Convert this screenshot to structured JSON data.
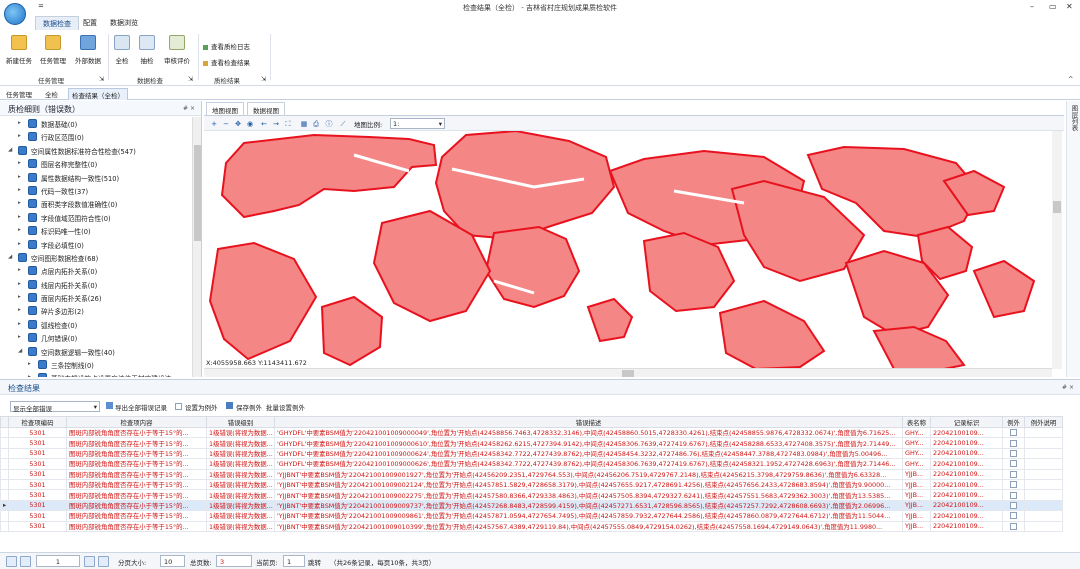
{
  "window": {
    "title": "检查结果（全检） - 吉林省村庄规划成果质检软件",
    "quick_access": "="
  },
  "menu_tabs": [
    "数据检查",
    "配置",
    "数据浏览"
  ],
  "ribbon": {
    "groups": [
      {
        "label": "任务管理",
        "buttons": [
          "新建任务",
          "任务管理",
          "外部数据"
        ]
      },
      {
        "label": "数据检查",
        "buttons": [
          "全检",
          "抽检",
          "审核评价"
        ]
      },
      {
        "label": "质检结果",
        "buttons": [
          "查看质检日志",
          "查看检查结果"
        ]
      }
    ]
  },
  "doc_tabs": [
    "任务管理",
    "全检",
    "检查结果（全检）"
  ],
  "left_panel": {
    "title": "质检细则（错误数）",
    "pin": "# ×",
    "tree": [
      {
        "label": "数据基础(0)",
        "level": 1,
        "expanded": false
      },
      {
        "label": "行政区范围(0)",
        "level": 1,
        "expanded": false
      },
      {
        "label": "空间属性数据标准符合性检查(547)",
        "level": 0,
        "expanded": true
      },
      {
        "label": "图层名称完整性(0)",
        "level": 1,
        "expanded": false
      },
      {
        "label": "属性数据结构一致性(510)",
        "level": 1,
        "expanded": false
      },
      {
        "label": "代码一致性(37)",
        "level": 1,
        "expanded": false
      },
      {
        "label": "面积类字段数值准确性(0)",
        "level": 1,
        "expanded": false
      },
      {
        "label": "字段值域范围符合性(0)",
        "level": 1,
        "expanded": false
      },
      {
        "label": "标识码唯一性(0)",
        "level": 1,
        "expanded": false
      },
      {
        "label": "字段必填性(0)",
        "level": 1,
        "expanded": false
      },
      {
        "label": "空间图形数据检查(68)",
        "level": 0,
        "expanded": true
      },
      {
        "label": "点层内拓扑关系(0)",
        "level": 1,
        "expanded": false
      },
      {
        "label": "线层内拓扑关系(0)",
        "level": 1,
        "expanded": false
      },
      {
        "label": "面层内拓扑关系(26)",
        "level": 1,
        "expanded": false
      },
      {
        "label": "碎片多边形(2)",
        "level": 1,
        "expanded": false
      },
      {
        "label": "弧线检查(0)",
        "level": 1,
        "expanded": false
      },
      {
        "label": "几何错误(0)",
        "level": 1,
        "expanded": false
      },
      {
        "label": "空间数据逻辑一致性(40)",
        "level": 1,
        "expanded": true
      },
      {
        "label": "三条控制线(0)",
        "level": 2,
        "expanded": false
      },
      {
        "label": "基础支撑设施点设置应该位于村庄建设边",
        "level": 2,
        "expanded": false
      }
    ]
  },
  "map": {
    "tabs": [
      "地图视图",
      "数据视图"
    ],
    "scale_label": "地图比例:",
    "scale_value": "1:",
    "coordinates": "X:4055958.663 Y:1143411.672",
    "fill_color": "#f48686",
    "stroke_color": "#e8121e"
  },
  "right_strip": {
    "label": "图层列表"
  },
  "results": {
    "title": "检查结果",
    "pin": "# ×",
    "filter_value": "显示全部错误",
    "toolbar": [
      "导出全部错误记录",
      "设置为例外",
      "保存例外",
      "批量设置例外"
    ],
    "columns": [
      "检查项编码",
      "检查项内容",
      "错误级别",
      "错误描述",
      "表名称",
      "记录标识",
      "例外",
      "例外说明"
    ],
    "rows": [
      {
        "code": "5301",
        "content": "图斑内部锐角角度否存在小于等于15°的...",
        "level": "1级错误(将视为数据...",
        "desc": "'GHYDFL'中要素BSM值为'220421001009000049',角位置为'开始点(42458856.7463,4728332.3146),中间点(42458860.5015,4728330.4261),结束点(42458855.9876,4728332.0674)',角度值为6.71625...",
        "table": "GHY...",
        "id": "22042100109..."
      },
      {
        "code": "5301",
        "content": "图斑内部锐角角度否存在小于等于15°的...",
        "level": "1级错误(将视为数据...",
        "desc": "'GHYDFL'中要素BSM值为'220421001009000610',角位置为'开始点(42458262.6215,4727394.9142),中间点(42458306.7639,4727419.6767),结束点(42458288.6533,4727408.3575)',角度值为2.71449...",
        "table": "GHY...",
        "id": "22042100109..."
      },
      {
        "code": "5301",
        "content": "图斑内部锐角角度否存在小于等于15°的...",
        "level": "1级错误(将视为数据...",
        "desc": "'GHYDFL'中要素BSM值为'220421001009000624',角位置为'开始点(42458342.7722,4727439.8762),中间点(42458454.3232,4727486.76),结束点(42458447.3788,4727483.0984)',角度值为5.00496...",
        "table": "GHY...",
        "id": "22042100109..."
      },
      {
        "code": "5301",
        "content": "图斑内部锐角角度否存在小于等于15°的...",
        "level": "1级错误(将视为数据...",
        "desc": "'GHYDFL'中要素BSM值为'220421001009000626',角位置为'开始点(42458342.7722,4727439.8762),中间点(42458306.7639,4727419.6767),结束点(42458321.1952,4727428.6963)',角度值为2.71446...",
        "table": "GHY...",
        "id": "22042100109..."
      },
      {
        "code": "5301",
        "content": "图斑内部锐角角度否存在小于等于15°的...",
        "level": "1级错误(将视为数据...",
        "desc": "'YJJBNT'中要素BSM值为'220421001009001927',角位置为'开始点(42456209.2351,4729764.553),中间点(42456206.7519,4729767.2148),结束点(42456215.3798,4729759.8636)',角度值为6.63328...",
        "table": "YJJB...",
        "id": "22042100109..."
      },
      {
        "code": "5301",
        "content": "图斑内部锐角角度否存在小于等于15°的...",
        "level": "1级错误(将视为数据...",
        "desc": "'YJJBNT'中要素BSM值为'220421001009002124',角位置为'开始点(42457851.5829,4728658.3179),中间点(42457655.9217,4728691.4256),结束点(42457656.2433,4728683.8594)',角度值为9.90000...",
        "table": "YJJB...",
        "id": "22042100109..."
      },
      {
        "code": "5301",
        "content": "图斑内部锐角角度否存在小于等于15°的...",
        "level": "1级错误(将视为数据...",
        "desc": "'YJJBNT'中要素BSM值为'220421001009002275',角位置为'开始点(42457580.8366,4729338.4863),中间点(42457505.8394,4729327.6241),结束点(42457551.5683,4729362.3003)',角度值为13.5385...",
        "table": "YJJB...",
        "id": "22042100109..."
      },
      {
        "code": "5301",
        "content": "图斑内部锐角角度否存在小于等于15°的...",
        "level": "1级错误(将视为数据...",
        "desc": "'YJJBNT'中要素BSM值为'220421001009009737',角位置为'开始点(42457268.8483,4728599.4159),中间点(42457271.6531,4728596.8565),结束点(42457257.7292,4728608.6693)',角度值为2.06996...",
        "table": "YJJB...",
        "id": "22042100109..."
      },
      {
        "code": "5301",
        "content": "图斑内部锐角角度否存在小于等于15°的...",
        "level": "1级错误(将视为数据...",
        "desc": "'YJJBNT'中要素BSM值为'220421001009009861',角位置为'开始点(42457871.0594,4727654.7495),中间点(42457859.7932,4727644.2586),结束点(42457860.0879,4727644.6712)',角度值为11.5044...",
        "table": "YJJB...",
        "id": "22042100109..."
      },
      {
        "code": "5301",
        "content": "图斑内部锐角角度否存在小于等于15°的...",
        "level": "1级错误(将视为数据...",
        "desc": "'YJJBNT'中要素BSM值为'220421001009010399',角位置为'开始点(42457567.4389,4729119.84),中间点(42457555.0849,4729154.0262),结束点(42457558.1694,4729149.0643)',角度值为11.9980...",
        "table": "YJJB...",
        "id": "22042100109..."
      }
    ],
    "selected_row": 7
  },
  "pager": {
    "page": "1",
    "page_size_label": "分页大小:",
    "page_size": "10",
    "total_pages_label": "总页数:",
    "total_pages": "3",
    "current_label": "当前页:",
    "current": "1",
    "go": "跳转",
    "summary": "（共26条记录，每页10条，共3页）"
  }
}
